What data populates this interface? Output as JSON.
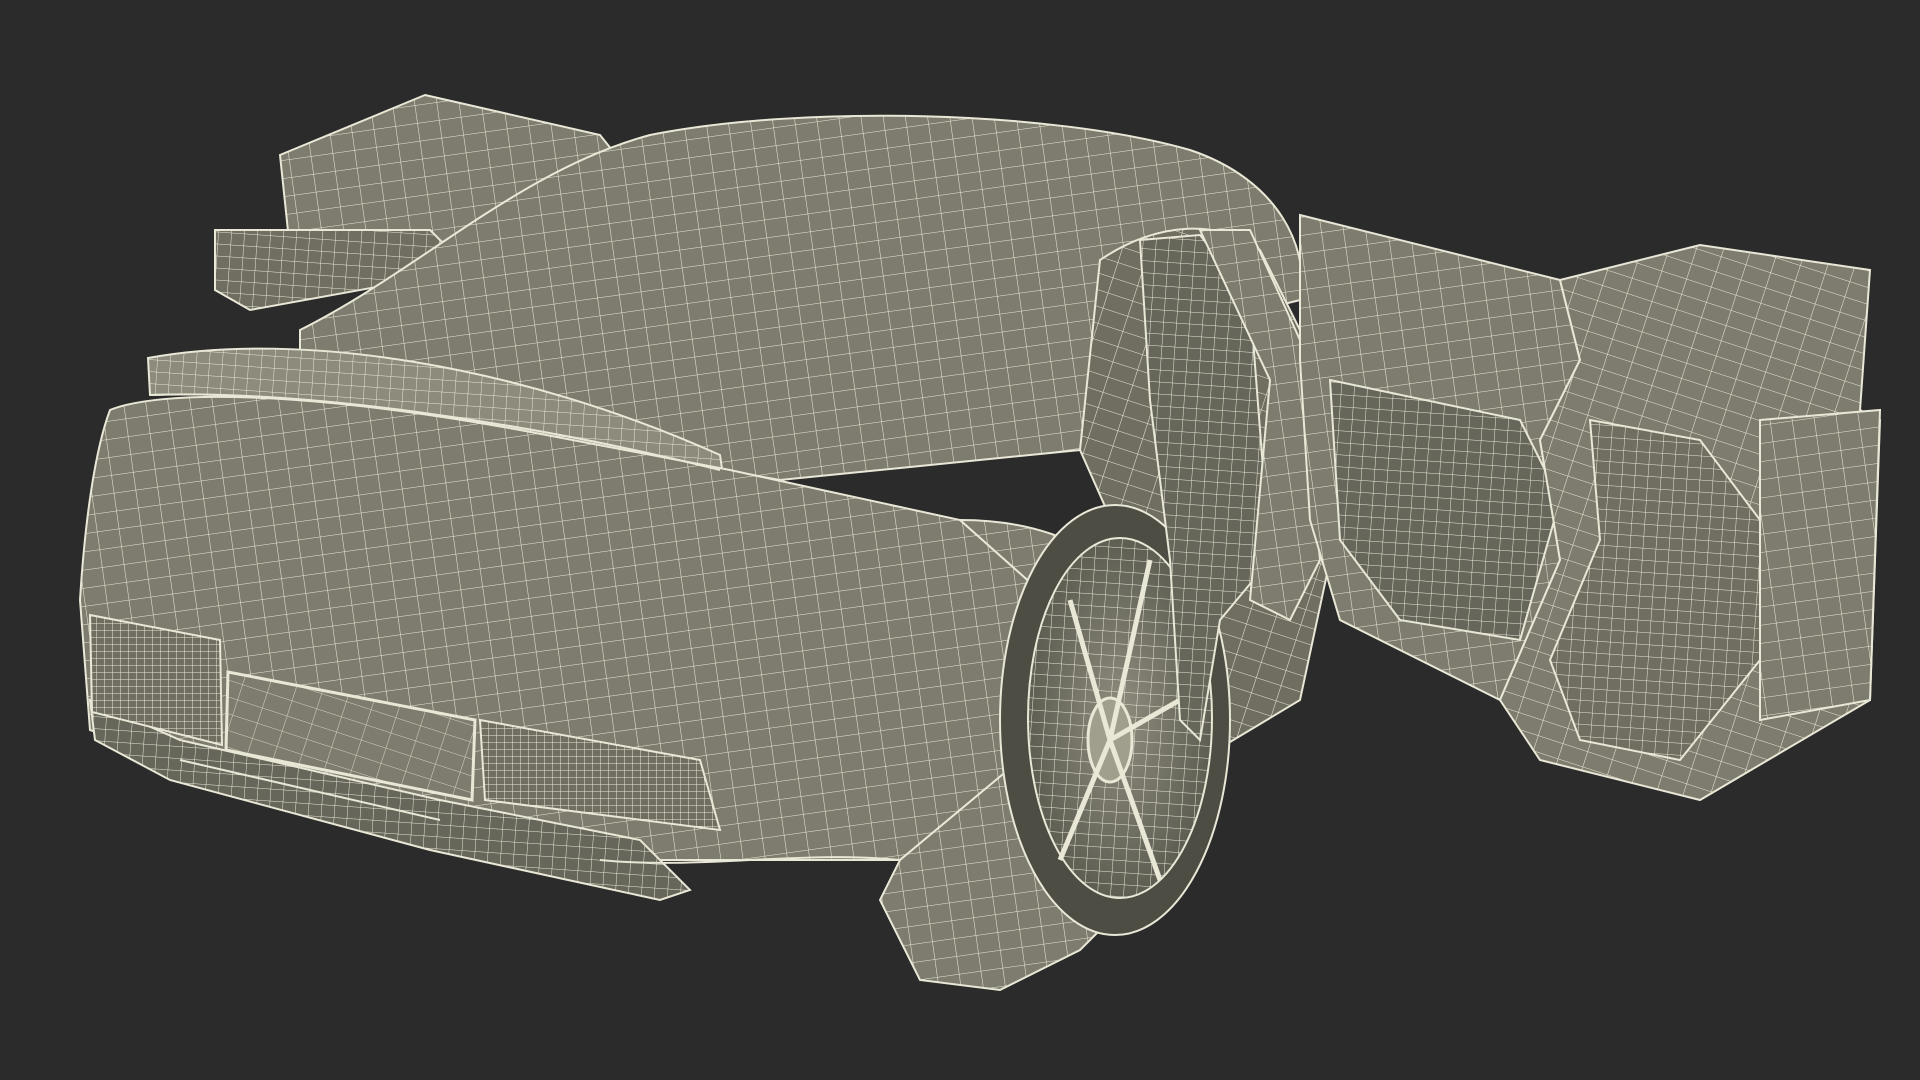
{
  "scene": {
    "subject": "wireframe-car-render",
    "colors": {
      "background": "#2b2b2b",
      "surface": "#7d7c6e",
      "surface_dark": "#67665a",
      "surface_light": "#8c8b7c",
      "wire": "#e9e7d6",
      "shadow": "#4e4d44"
    }
  }
}
